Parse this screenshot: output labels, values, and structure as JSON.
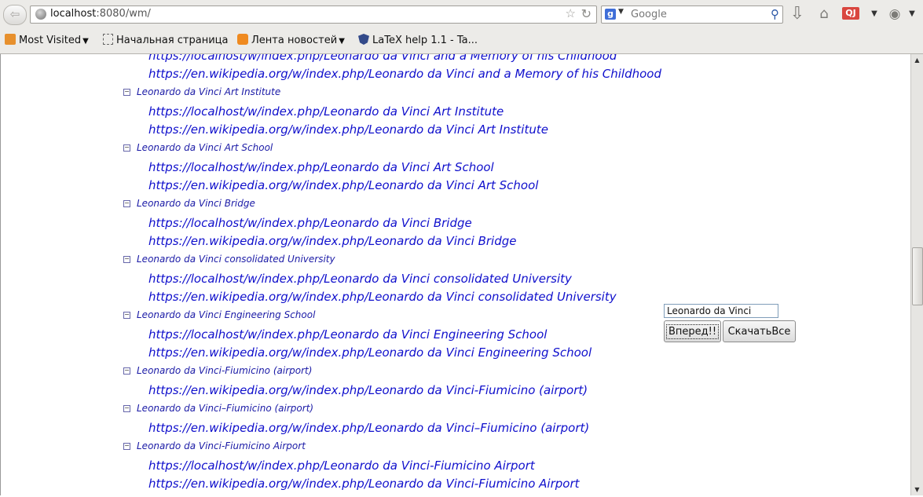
{
  "browser": {
    "url_host": "localhost",
    "url_rest": ":8080/wm/",
    "search_placeholder": "Google",
    "qj_label": "QJ",
    "bookmarks": [
      {
        "label": "Most Visited",
        "icon": "most-visited-icon",
        "dropdown": true
      },
      {
        "label": "Начальная страница",
        "icon": "page-icon",
        "dropdown": false
      },
      {
        "label": "Лента новостей",
        "icon": "rss-icon",
        "dropdown": true
      },
      {
        "label": "LaTeX help 1.1 - Ta...",
        "icon": "shield-icon",
        "dropdown": false
      }
    ]
  },
  "tree": [
    {
      "title": null,
      "links": [
        "https://localhost/w/index.php/Leonardo da Vinci and a Memory of his Childhood",
        "https://en.wikipedia.org/w/index.php/Leonardo da Vinci and a Memory of his Childhood"
      ]
    },
    {
      "title": "Leonardo da Vinci Art Institute",
      "links": [
        "https://localhost/w/index.php/Leonardo da Vinci Art Institute",
        "https://en.wikipedia.org/w/index.php/Leonardo da Vinci Art Institute"
      ]
    },
    {
      "title": "Leonardo da Vinci Art School",
      "links": [
        "https://localhost/w/index.php/Leonardo da Vinci Art School",
        "https://en.wikipedia.org/w/index.php/Leonardo da Vinci Art School"
      ]
    },
    {
      "title": "Leonardo da Vinci Bridge",
      "links": [
        "https://localhost/w/index.php/Leonardo da Vinci Bridge",
        "https://en.wikipedia.org/w/index.php/Leonardo da Vinci Bridge"
      ]
    },
    {
      "title": "Leonardo da Vinci consolidated University",
      "links": [
        "https://localhost/w/index.php/Leonardo da Vinci consolidated University",
        "https://en.wikipedia.org/w/index.php/Leonardo da Vinci consolidated University"
      ]
    },
    {
      "title": "Leonardo da Vinci Engineering School",
      "links": [
        "https://localhost/w/index.php/Leonardo da Vinci Engineering School",
        "https://en.wikipedia.org/w/index.php/Leonardo da Vinci Engineering School"
      ]
    },
    {
      "title": "Leonardo da Vinci-Fiumicino (airport)",
      "links": [
        "https://en.wikipedia.org/w/index.php/Leonardo da Vinci-Fiumicino (airport)"
      ]
    },
    {
      "title": "Leonardo da Vinci–Fiumicino (airport)",
      "links": [
        "https://en.wikipedia.org/w/index.php/Leonardo da Vinci–Fiumicino (airport)"
      ]
    },
    {
      "title": "Leonardo da Vinci-Fiumicino Airport",
      "links": [
        "https://localhost/w/index.php/Leonardo da Vinci-Fiumicino Airport",
        "https://en.wikipedia.org/w/index.php/Leonardo da Vinci-Fiumicino Airport"
      ]
    }
  ],
  "form": {
    "search_value": "Leonardo da Vinci",
    "forward_label": "Вперед!!",
    "download_label": "СкачатьВсе"
  }
}
